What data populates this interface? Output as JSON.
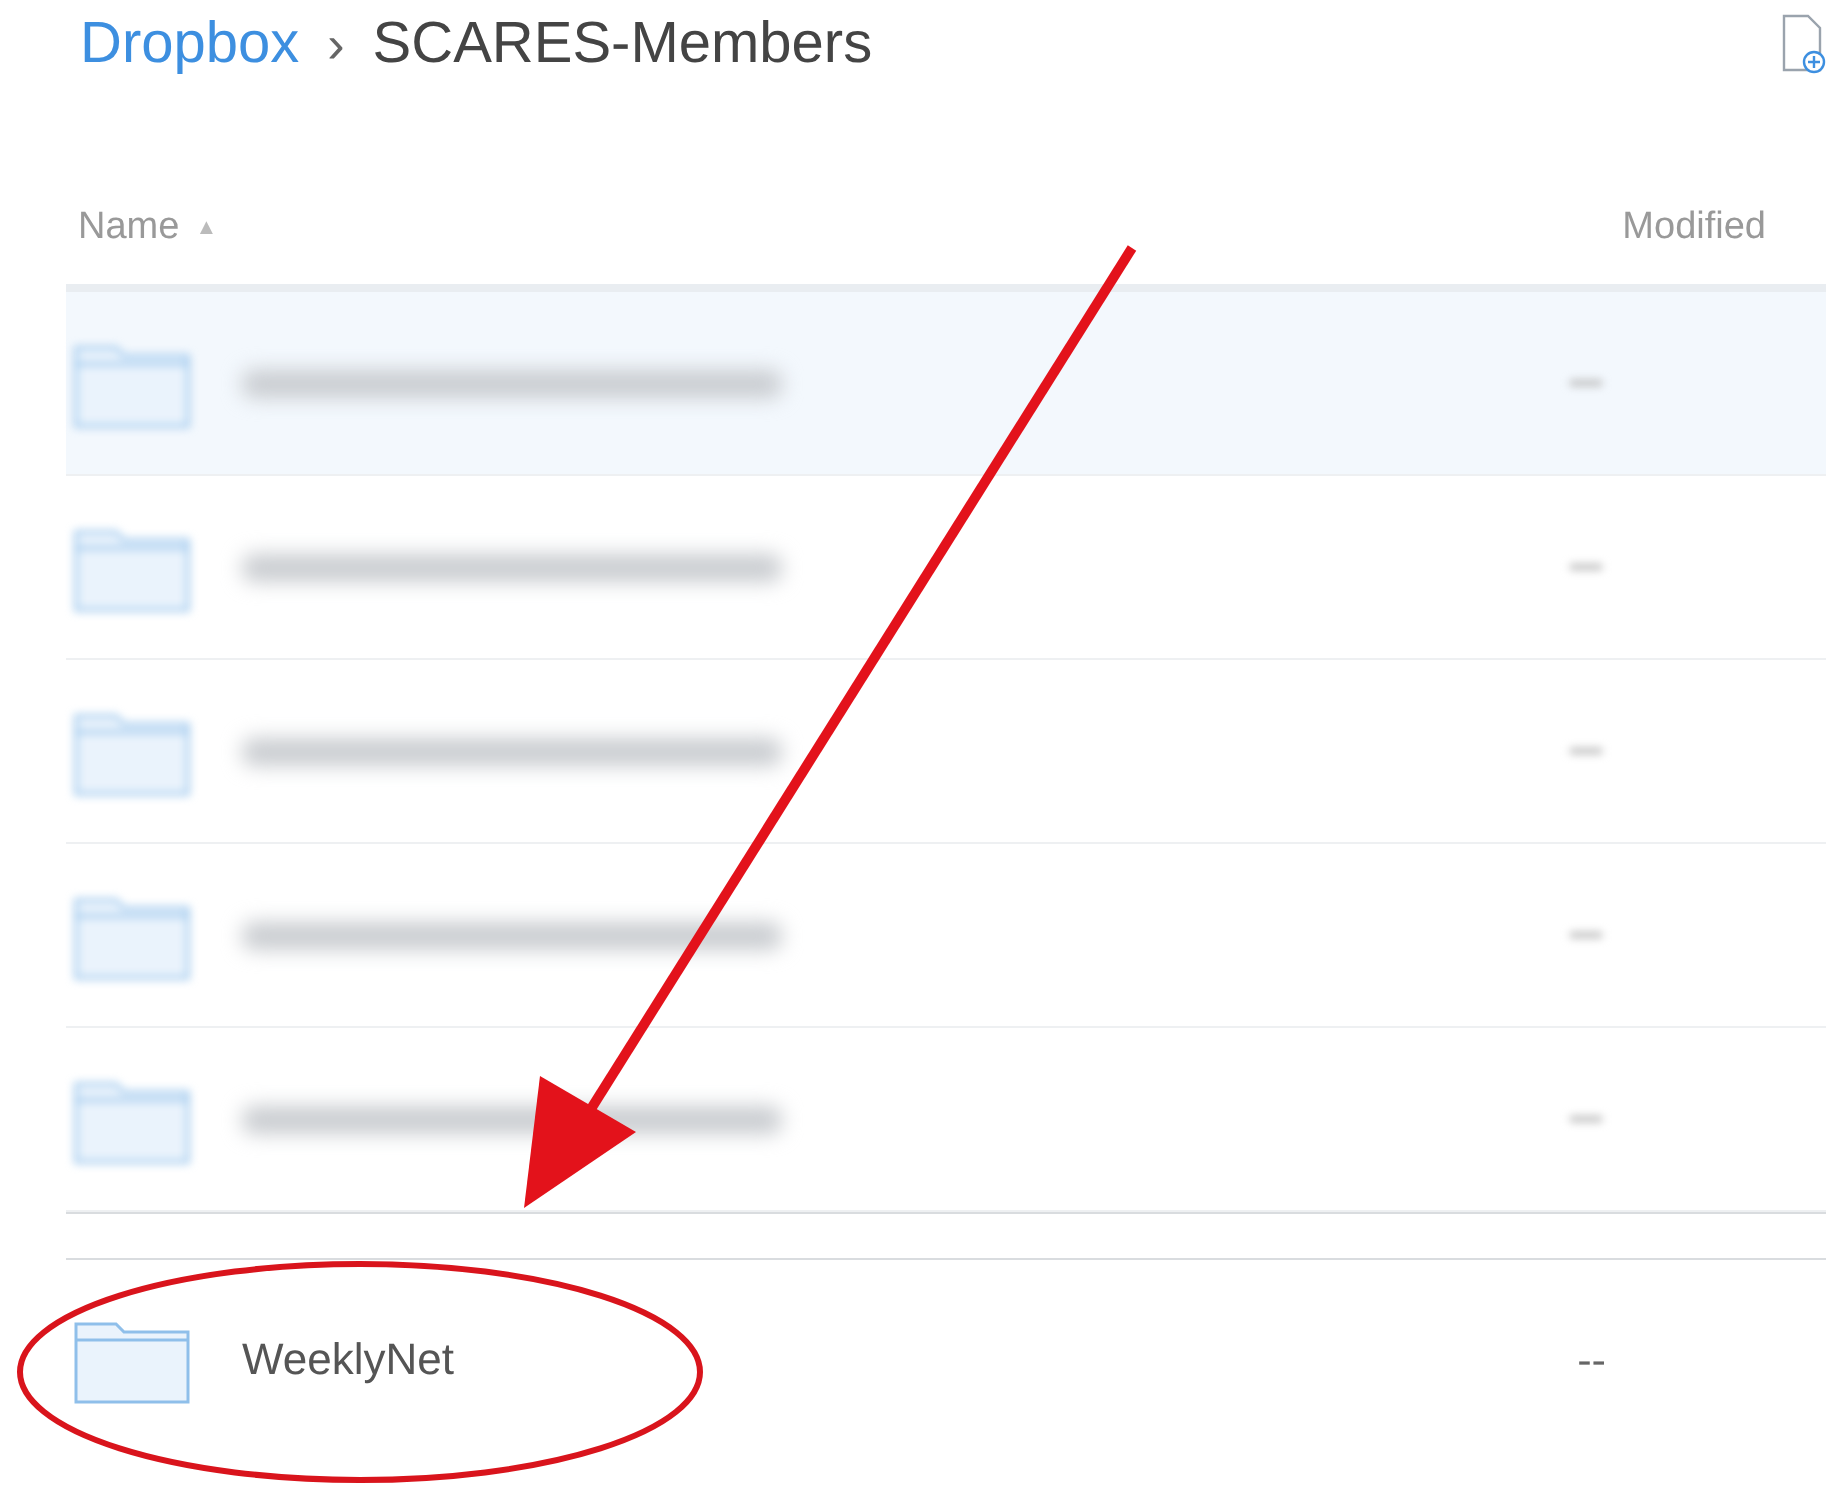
{
  "breadcrumb": [
    {
      "label": "Dropbox",
      "kind": "link"
    },
    {
      "label": "›",
      "kind": "separator"
    },
    {
      "label": "SCARES-Members",
      "kind": "current"
    }
  ],
  "table": {
    "columns": [
      {
        "label": "Name",
        "sort": "▲"
      },
      {
        "label": "Modified"
      }
    ],
    "rows": [
      {
        "kind": "blurred",
        "selected": true
      },
      {
        "kind": "blurred",
        "selected": false
      },
      {
        "kind": "blurred",
        "selected": false
      },
      {
        "kind": "blurred",
        "selected": false
      },
      {
        "kind": "blurred",
        "selected": false
      },
      {
        "kind": "folder",
        "name": "WeeklyNet",
        "modified": "--",
        "selected": false
      }
    ]
  }
}
